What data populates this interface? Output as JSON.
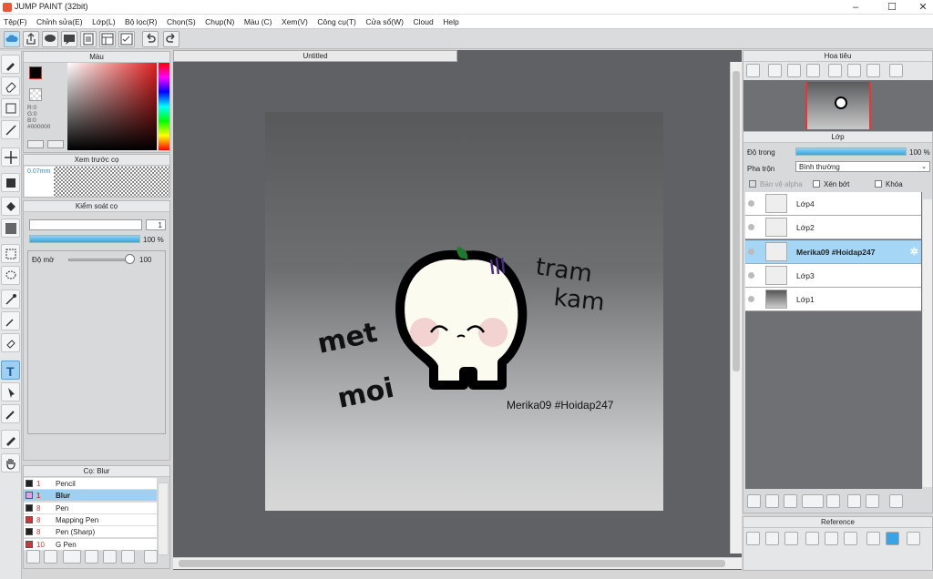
{
  "window": {
    "title": "JUMP PAINT (32bit)"
  },
  "menu": [
    "Tệp(F)",
    "Chỉnh sửa(E)",
    "Lớp(L)",
    "Bộ lọc(R)",
    "Chọn(S)",
    "Chụp(N)",
    "Màu (C)",
    "Xem(V)",
    "Công cụ(T)",
    "Cửa sổ(W)",
    "Cloud",
    "Help"
  ],
  "panels": {
    "color": {
      "title": "Màu",
      "r": "R:0",
      "g": "G:0",
      "b": "B:0",
      "hex": "#000000"
    },
    "brush_preview": {
      "title": "Xem trước cọ",
      "size": "0.07mm"
    },
    "brush_control": {
      "title": "Kiểm soát cọ",
      "size": "1",
      "opacity_pct": "100 %",
      "blur_label": "Độ mờ",
      "blur_value": "100"
    },
    "brush_list": {
      "title": "Cọ: Blur",
      "items": [
        {
          "size": "1",
          "name": "Pencil",
          "color": "#222222"
        },
        {
          "size": "1",
          "name": "Blur",
          "color": "#e0a0f0"
        },
        {
          "size": "8",
          "name": "Pen",
          "color": "#222222"
        },
        {
          "size": "8",
          "name": "Mapping Pen",
          "color": "#d33333"
        },
        {
          "size": "8",
          "name": "Pen (Sharp)",
          "color": "#222222"
        },
        {
          "size": "10",
          "name": "G Pen",
          "color": "#d33333"
        }
      ]
    },
    "document": {
      "tab": "Untitled"
    },
    "navigator": {
      "title": "Hoa tiêu"
    },
    "layers": {
      "title": "Lớp",
      "opacity_label": "Độ trong",
      "opacity_value": "100 %",
      "blend_label": "Pha trộn",
      "blend_value": "Bình thường",
      "protect_alpha": "Bảo vệ alpha",
      "clip": "Xén bớt",
      "lock": "Khóa",
      "items": [
        {
          "name": "Lớp4"
        },
        {
          "name": "Lớp2"
        },
        {
          "name": "Merika09 #Hoidap247"
        },
        {
          "name": "Lớp3"
        },
        {
          "name": "Lớp1"
        }
      ]
    },
    "reference": {
      "title": "Reference"
    }
  },
  "artwork": {
    "text_signature": "Merika09 #Hoidap247",
    "text_left_1": "met",
    "text_left_2": "moi",
    "text_right_1": "tram",
    "text_right_2": "kam"
  }
}
